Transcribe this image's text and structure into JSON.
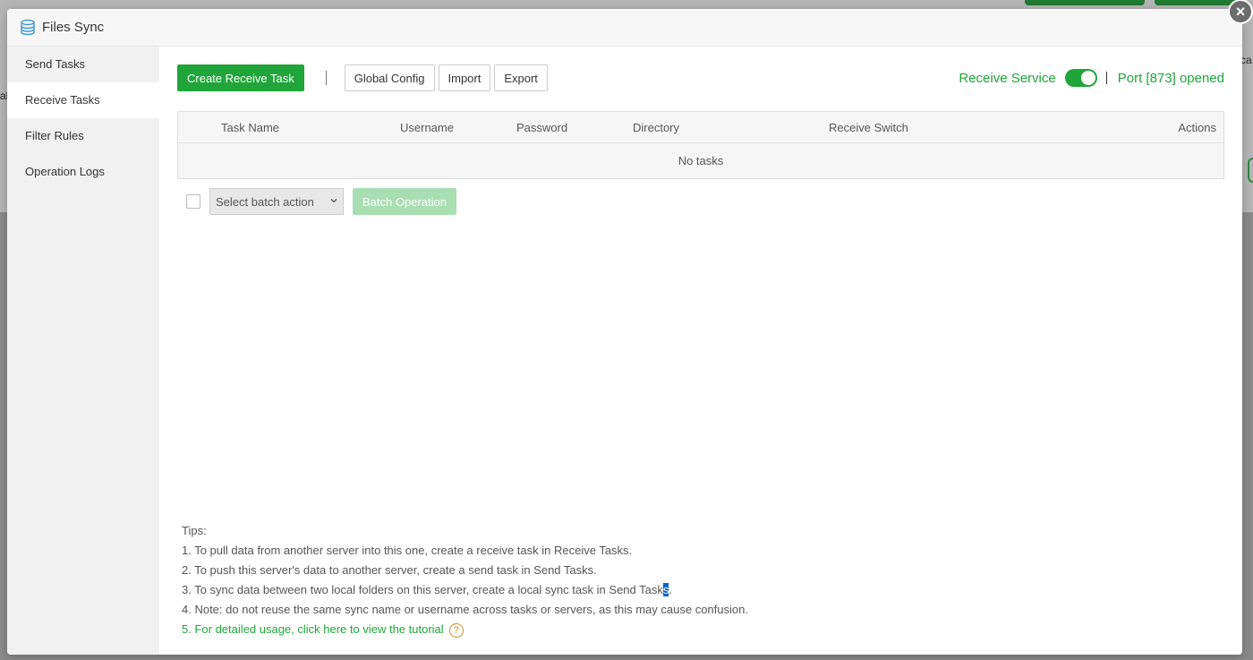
{
  "background": {
    "left_text": "al",
    "right_text": "ca"
  },
  "modal": {
    "title": "Files Sync",
    "close_label": "×"
  },
  "sidebar": {
    "items": [
      {
        "label": "Send Tasks"
      },
      {
        "label": "Receive Tasks"
      },
      {
        "label": "Filter Rules"
      },
      {
        "label": "Operation Logs"
      }
    ],
    "active_index": 1
  },
  "toolbar": {
    "create_label": "Create Receive Task",
    "global_config_label": "Global Config",
    "import_label": "Import",
    "export_label": "Export"
  },
  "service": {
    "label": "Receive Service",
    "enabled": true,
    "port_status": "Port [873] opened"
  },
  "table": {
    "columns": [
      "Task Name",
      "Username",
      "Password",
      "Directory",
      "Receive Switch",
      "Actions"
    ],
    "empty_text": "No tasks"
  },
  "batch": {
    "select_placeholder": "Select batch action",
    "button_label": "Batch Operation"
  },
  "tips": {
    "heading": "Tips:",
    "item1": "1. To pull data from another server into this one, create a receive task in Receive Tasks.",
    "item2": "2. To push this server's data to another server, create a send task in Send Tasks.",
    "item3_a": "3. To sync data between two local folders on this server, create a local sync task in Send Task",
    "item3_b": "s",
    "item3_c": ".",
    "item4": "4. Note: do not reuse the same sync name or username across tasks or servers, as this may cause confusion.",
    "item5_prefix": "5. ",
    "item5_link": "For detailed usage, click here to view the tutorial",
    "help_glyph": "?"
  },
  "colors": {
    "accent": "#20a53a",
    "accent_disabled": "#a8deb2",
    "help": "#e08a1e"
  }
}
